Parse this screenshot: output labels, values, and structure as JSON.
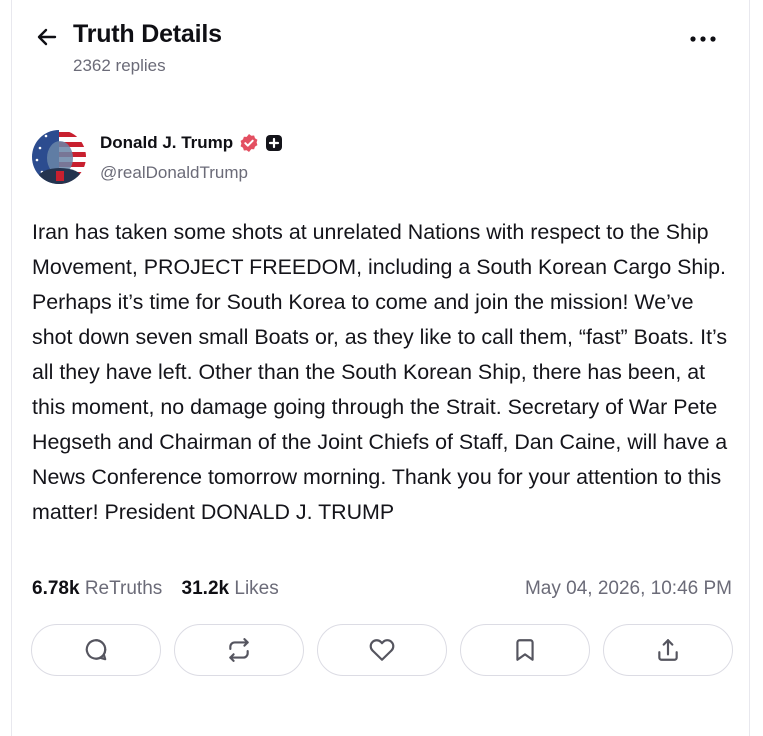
{
  "header": {
    "title": "Truth Details",
    "replies": "2362 replies"
  },
  "author": {
    "name": "Donald J. Trump",
    "handle": "@realDonaldTrump"
  },
  "post": {
    "text": "Iran has taken some shots at unrelated Nations with respect to the Ship Movement, PROJECT FREEDOM, including a South Korean Cargo Ship. Perhaps it’s time for South Korea to come and join the mission! We’ve shot down seven small Boats or, as they like to call them, “fast” Boats. It’s all they have left. Other than the South Korean Ship, there has been, at this moment, no damage going through the Strait. Secretary of War Pete Hegseth and Chairman of the Joint Chiefs of Staff, Dan Caine, will have a News Conference tomorrow morning. Thank you for your attention to this matter! President DONALD J. TRUMP"
  },
  "stats": {
    "retruths_count": "6.78k",
    "retruths_label": "ReTruths",
    "likes_count": "31.2k",
    "likes_label": "Likes",
    "timestamp": "May 04, 2026, 10:46 PM"
  },
  "icons": {
    "back": "arrow-left-icon",
    "more": "more-horizontal-icon",
    "verified": "verified-badge-icon",
    "plus": "plus-badge-icon",
    "reply": "reply-icon",
    "retruth": "retruth-icon",
    "like": "heart-icon",
    "bookmark": "bookmark-icon",
    "share": "share-icon"
  },
  "colors": {
    "verified": "#e34f61",
    "text": "#0f0f14",
    "muted": "#6b6b78",
    "border": "#dcdce4"
  }
}
